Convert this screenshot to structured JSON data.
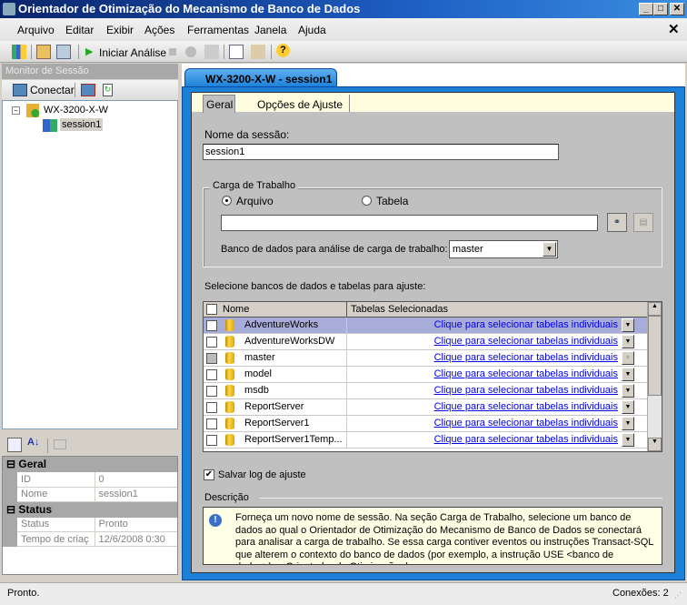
{
  "window": {
    "title": "Orientador de Otimização do Mecanismo de Banco de Dados"
  },
  "menu": [
    "Arquivo",
    "Editar",
    "Exibir",
    "Ações",
    "Ferramentas",
    "Janela",
    "Ajuda"
  ],
  "toolbar": {
    "start_label": "Iniciar Análise"
  },
  "session_monitor": {
    "title": "Monitor de Sessão",
    "connect_label": "Conectar",
    "server": "WX-3200-X-W",
    "session": "session1"
  },
  "properties": {
    "groups": [
      {
        "name": "Geral",
        "rows": [
          {
            "key": "ID",
            "value": "0"
          },
          {
            "key": "Nome",
            "value": "session1"
          }
        ]
      },
      {
        "name": "Status",
        "rows": [
          {
            "key": "Status",
            "value": "Pronto"
          },
          {
            "key": "Tempo de criaç",
            "value": "12/6/2008 0:30"
          }
        ]
      }
    ]
  },
  "doc_tab": "WX-3200-X-W - session1",
  "tabs": [
    "Geral",
    "Opções de Ajuste"
  ],
  "general": {
    "session_name_label": "Nome da sessão:",
    "session_name": "session1",
    "workload_group": "Carga de Trabalho",
    "radio_file": "Arquivo",
    "radio_table": "Tabela",
    "workload_path": "",
    "db_label": "Banco de dados para análise de carga de trabalho:",
    "db_value": "master",
    "select_label": "Selecione bancos de dados e tabelas para ajuste:",
    "col_name": "Nome",
    "col_tables": "Tabelas Selecionadas",
    "rows": [
      {
        "name": "AdventureWorks",
        "tables": "Clique para selecionar tabelas individuais"
      },
      {
        "name": "AdventureWorksDW",
        "tables": "Clique para selecionar tabelas individuais"
      },
      {
        "name": "master",
        "tables": "Clique para selecionar tabelas individuais"
      },
      {
        "name": "model",
        "tables": "Clique para selecionar tabelas individuais"
      },
      {
        "name": "msdb",
        "tables": "Clique para selecionar tabelas individuais"
      },
      {
        "name": "ReportServer",
        "tables": "Clique para selecionar tabelas individuais"
      },
      {
        "name": "ReportServer1",
        "tables": "Clique para selecionar tabelas individuais"
      },
      {
        "name": "ReportServer1Temp...",
        "tables": "Clique para selecionar tabelas individuais"
      }
    ],
    "save_log_label": "Salvar log de ajuste",
    "description_label": "Descrição",
    "description": "Forneça um novo nome de sessão. Na seção Carga de Trabalho, selecione um banco de dados ao qual o Orientador de Otimização do Mecanismo de Banco de Dados se conectará para analisar a carga de trabalho. Se essa carga contiver eventos ou instruções Transact-SQL que alterem o contexto do banco de dados (por exemplo, a instrução USE <banco de dados>), o Orientador de Otimização do"
  },
  "status": {
    "left": "Pronto.",
    "right": "Conexões: 2"
  }
}
